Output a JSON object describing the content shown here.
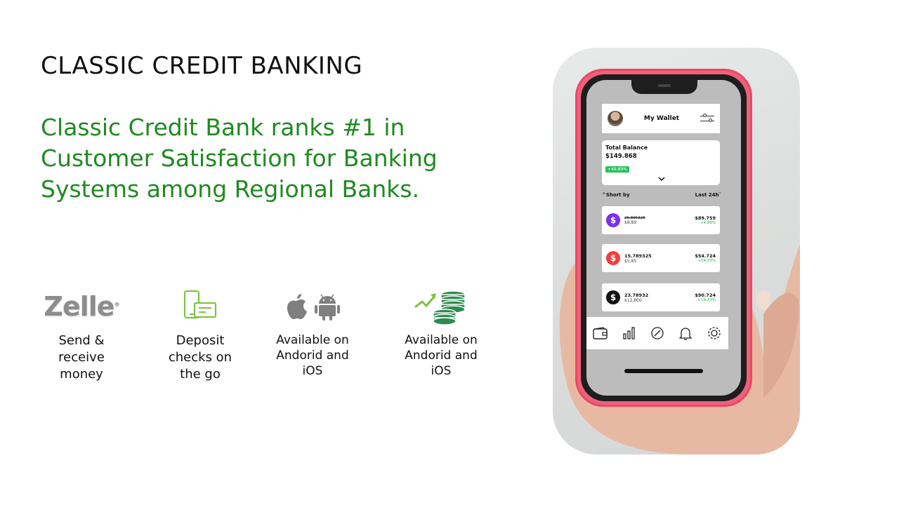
{
  "header": {
    "title": "CLASSIC CREDIT BANKING",
    "tagline": "Classic Credit Bank ranks #1 in Customer Satisfaction for Banking Systems among Regional Banks."
  },
  "features": [
    {
      "icon": "zelle-logo",
      "logo_text": "Zelle",
      "label": "Send & receive money"
    },
    {
      "icon": "mobile-check-deposit-icon",
      "label": "Deposit checks on the go"
    },
    {
      "icon": "apple-android-icon",
      "label": "Available on Andorid and iOS"
    },
    {
      "icon": "coins-growth-icon",
      "label": "Available on Andorid and iOS"
    }
  ],
  "phone": {
    "wallet_title": "My Wallet",
    "balance": {
      "label": "Total Balance",
      "amount": "$149.868",
      "change": "+49,89%"
    },
    "sort": {
      "left": "Short by",
      "right": "Last 24h"
    },
    "coins": [
      {
        "amount": "25.895325",
        "sub": "$8,89",
        "price": "$89.759",
        "change": "+4,89%",
        "color": "#7b2ff2"
      },
      {
        "amount": "15.789325",
        "sub": "$5,85",
        "price": "$54.724",
        "change": "+54,23%",
        "color": "#f03e3e"
      },
      {
        "amount": "23.78932",
        "sub": "$12,800",
        "price": "$90.724",
        "change": "+19,23%",
        "color": "#111111"
      }
    ],
    "tabs": [
      "wallet-icon",
      "chart-icon",
      "compass-icon",
      "bell-icon",
      "gear-icon"
    ]
  },
  "colors": {
    "accent_green": "#1f8a1f",
    "phone_case": "#f0607a"
  }
}
